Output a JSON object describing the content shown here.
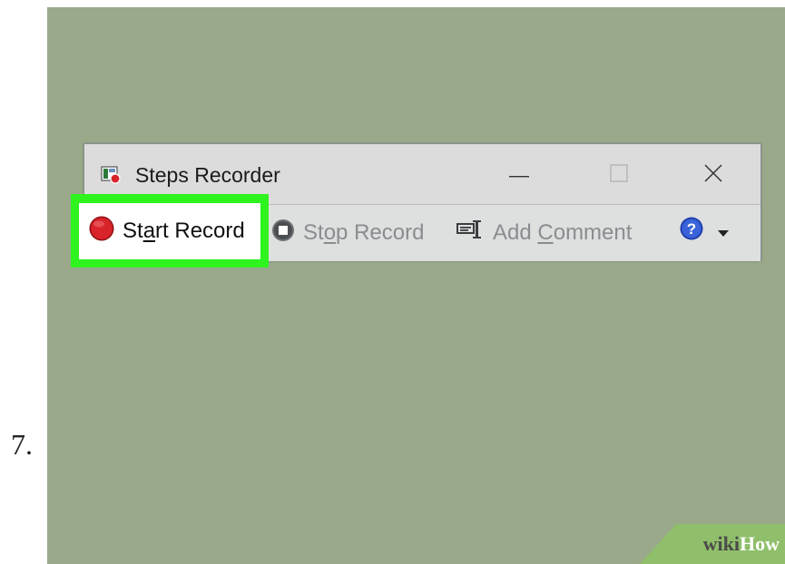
{
  "step": {
    "number": "7."
  },
  "window": {
    "title": "Steps Recorder",
    "controls": {
      "minimize_glyph": "—",
      "maximize_glyph": "☐",
      "close_glyph": "✕"
    }
  },
  "toolbar": {
    "start_record": {
      "pre": "St",
      "mnemonic": "a",
      "post": "rt Record",
      "icon": "record-icon",
      "highlighted": true
    },
    "stop_record": {
      "pre": "St",
      "mnemonic": "o",
      "post": "p Record",
      "icon": "stop-icon",
      "enabled": false
    },
    "add_comment": {
      "pre": "Add ",
      "mnemonic": "C",
      "post": "omment",
      "icon": "comment-icon",
      "enabled": false
    },
    "help": {
      "glyph": "?",
      "icon": "help-icon",
      "caret": "▾"
    }
  },
  "watermark": {
    "wiki": "wiki",
    "how": "How"
  },
  "colors": {
    "background": "#99a98a",
    "highlight": "#2ef31e",
    "record_red": "#d8232a",
    "help_blue": "#1f3fb0"
  }
}
